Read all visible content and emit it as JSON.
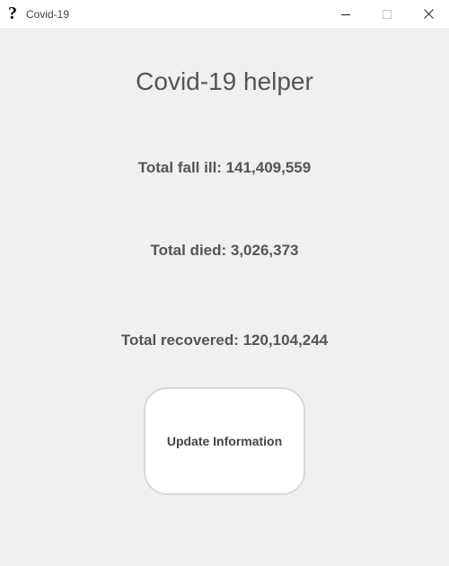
{
  "window": {
    "title": "Covid-19",
    "icon_glyph": "?",
    "controls": [
      "minimize-icon",
      "maximize-icon",
      "close-icon"
    ]
  },
  "main": {
    "heading": "Covid-19 helper",
    "stats": {
      "fall_ill": "Total fall ill: 141,409,559",
      "died": "Total died: 3,026,373",
      "recovered": "Total recovered: 120,104,244"
    },
    "update_button_label": "Update Information"
  },
  "colors": {
    "background": "#f0f0f0",
    "titlebar": "#ffffff",
    "text": "#555555",
    "button_bg": "#ffffff",
    "button_border": "#d8d8d8"
  }
}
